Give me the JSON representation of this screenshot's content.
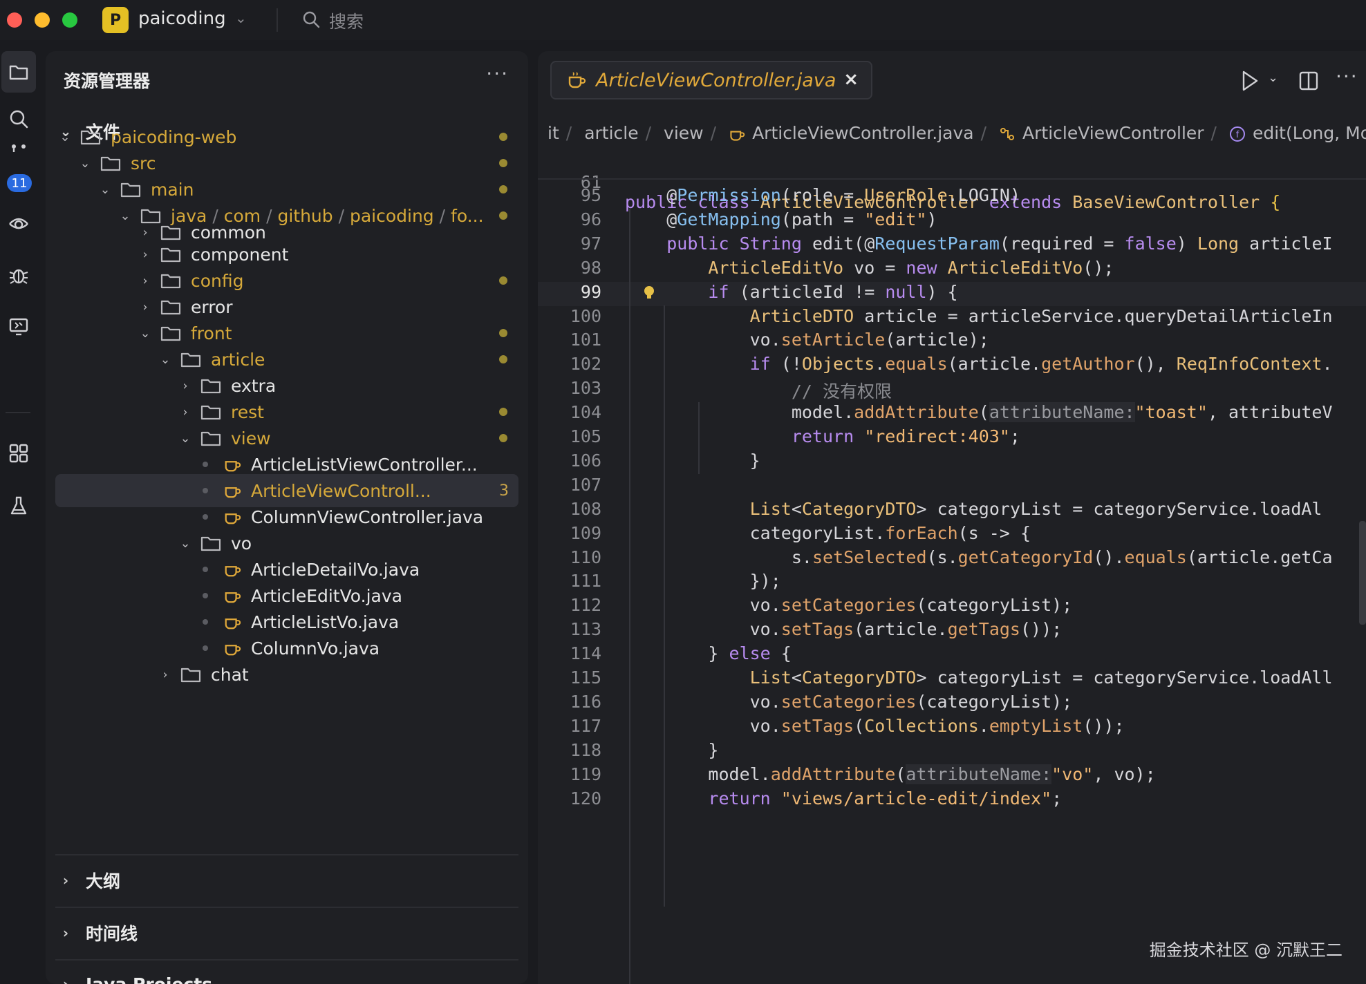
{
  "titlebar": {
    "project_initial": "P",
    "project_name": "paicoding",
    "search_label": "搜索"
  },
  "activity": {
    "badge": "11"
  },
  "explorer": {
    "title": "资源管理器",
    "files_section": "文件",
    "tree": [
      {
        "label": "paicoding-web",
        "kind": "folder",
        "expanded": true,
        "color": "yellow",
        "modified": true
      },
      {
        "label": "src",
        "kind": "folder",
        "expanded": true,
        "color": "yellow",
        "modified": true
      },
      {
        "label": "main",
        "kind": "folder",
        "expanded": true,
        "color": "yellow",
        "modified": true
      },
      {
        "label_parts": [
          "java",
          "com",
          "github",
          "paicoding",
          "fo..."
        ],
        "kind": "folder",
        "expanded": true,
        "color": "yellow",
        "modified": true
      },
      {
        "label": "common",
        "kind": "folder",
        "expanded": false,
        "color": "white"
      },
      {
        "label": "component",
        "kind": "folder",
        "expanded": false,
        "color": "white"
      },
      {
        "label": "config",
        "kind": "folder",
        "expanded": false,
        "color": "yellow",
        "modified": true
      },
      {
        "label": "error",
        "kind": "folder",
        "expanded": false,
        "color": "white"
      },
      {
        "label": "front",
        "kind": "folder",
        "expanded": true,
        "color": "yellow",
        "modified": true
      },
      {
        "label": "article",
        "kind": "folder",
        "expanded": true,
        "color": "yellow",
        "modified": true
      },
      {
        "label": "extra",
        "kind": "folder",
        "expanded": false,
        "color": "white"
      },
      {
        "label": "rest",
        "kind": "folder",
        "expanded": false,
        "color": "yellow",
        "modified": true
      },
      {
        "label": "view",
        "kind": "folder",
        "expanded": true,
        "color": "yellow",
        "modified": true
      },
      {
        "label": "ArticleListViewController...",
        "kind": "java",
        "color": "white"
      },
      {
        "label": "ArticleViewControll...",
        "kind": "java",
        "color": "yellow",
        "selected": true,
        "count": "3"
      },
      {
        "label": "ColumnViewController.java",
        "kind": "java",
        "color": "white"
      },
      {
        "label": "vo",
        "kind": "folder",
        "expanded": true,
        "color": "white"
      },
      {
        "label": "ArticleDetailVo.java",
        "kind": "java",
        "color": "white"
      },
      {
        "label": "ArticleEditVo.java",
        "kind": "java",
        "color": "white"
      },
      {
        "label": "ArticleListVo.java",
        "kind": "java",
        "color": "white"
      },
      {
        "label": "ColumnVo.java",
        "kind": "java",
        "color": "white"
      },
      {
        "label": "chat",
        "kind": "folder",
        "expanded": false,
        "color": "white"
      }
    ],
    "outline_section": "大纲",
    "timeline_section": "时间线",
    "java_projects_section": "Java Projects"
  },
  "editor": {
    "tab_label": "ArticleViewController.java",
    "tab_close": "×",
    "breadcrumb": [
      "it",
      "article",
      "view",
      "ArticleViewController.java",
      "ArticleViewController",
      "edit(Long, Mode"
    ],
    "sticky_line": {
      "num": "61",
      "text": "public class ArticleViewController extends BaseViewController {"
    },
    "current_line": "99",
    "lines": [
      {
        "num": "95",
        "text": "    @Permission(role = UserRole.LOGIN)"
      },
      {
        "num": "96",
        "text": "    @GetMapping(path = \"edit\")"
      },
      {
        "num": "97",
        "text": "    public String edit(@RequestParam(required = false) Long articleI"
      },
      {
        "num": "98",
        "text": "        ArticleEditVo vo = new ArticleEditVo();"
      },
      {
        "num": "99",
        "text": "        if (articleId != null) {"
      },
      {
        "num": "100",
        "text": "            ArticleDTO article = articleService.queryDetailArticleIn"
      },
      {
        "num": "101",
        "text": "            vo.setArticle(article);"
      },
      {
        "num": "102",
        "text": "            if (!Objects.equals(article.getAuthor(), ReqInfoContext."
      },
      {
        "num": "103",
        "text": "                // 没有权限"
      },
      {
        "num": "104",
        "text": "                model.addAttribute(attributeName:\"toast\", attributeV"
      },
      {
        "num": "105",
        "text": "                return \"redirect:403\";"
      },
      {
        "num": "106",
        "text": "            }"
      },
      {
        "num": "107",
        "text": ""
      },
      {
        "num": "108",
        "text": "            List<CategoryDTO> categoryList = categoryService.loadAl"
      },
      {
        "num": "109",
        "text": "            categoryList.forEach(s -> {"
      },
      {
        "num": "110",
        "text": "                s.setSelected(s.getCategoryId().equals(article.getCa"
      },
      {
        "num": "111",
        "text": "            });"
      },
      {
        "num": "112",
        "text": "            vo.setCategories(categoryList);"
      },
      {
        "num": "113",
        "text": "            vo.setTags(article.getTags());"
      },
      {
        "num": "114",
        "text": "        } else {"
      },
      {
        "num": "115",
        "text": "            List<CategoryDTO> categoryList = categoryService.loadAll"
      },
      {
        "num": "116",
        "text": "            vo.setCategories(categoryList);"
      },
      {
        "num": "117",
        "text": "            vo.setTags(Collections.emptyList());"
      },
      {
        "num": "118",
        "text": "        }"
      },
      {
        "num": "119",
        "text": "        model.addAttribute(attributeName:\"vo\", vo);"
      },
      {
        "num": "120",
        "text": "        return \"views/article-edit/index\";"
      }
    ]
  },
  "watermark": "掘金技术社区 @ 沉默王二",
  "colors": {
    "accent_yellow": "#d6a93a",
    "keyword": "#b88cf0",
    "badge_blue": "#2a6be0"
  }
}
